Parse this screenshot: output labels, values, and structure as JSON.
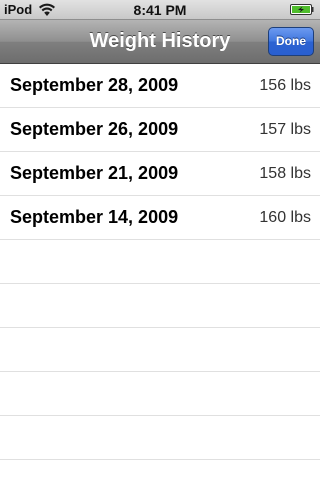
{
  "status_bar": {
    "carrier": "iPod",
    "time": "8:41 PM",
    "wifi_icon": "wifi-icon",
    "battery_icon": "battery-charging-icon"
  },
  "nav_bar": {
    "title": "Weight History",
    "done_label": "Done",
    "done_color": "#3f75dd"
  },
  "entries": [
    {
      "date": "September 28, 2009",
      "weight": "156 lbs"
    },
    {
      "date": "September 26, 2009",
      "weight": "157 lbs"
    },
    {
      "date": "September 21, 2009",
      "weight": "158 lbs"
    },
    {
      "date": "September 14, 2009",
      "weight": "160 lbs"
    }
  ]
}
